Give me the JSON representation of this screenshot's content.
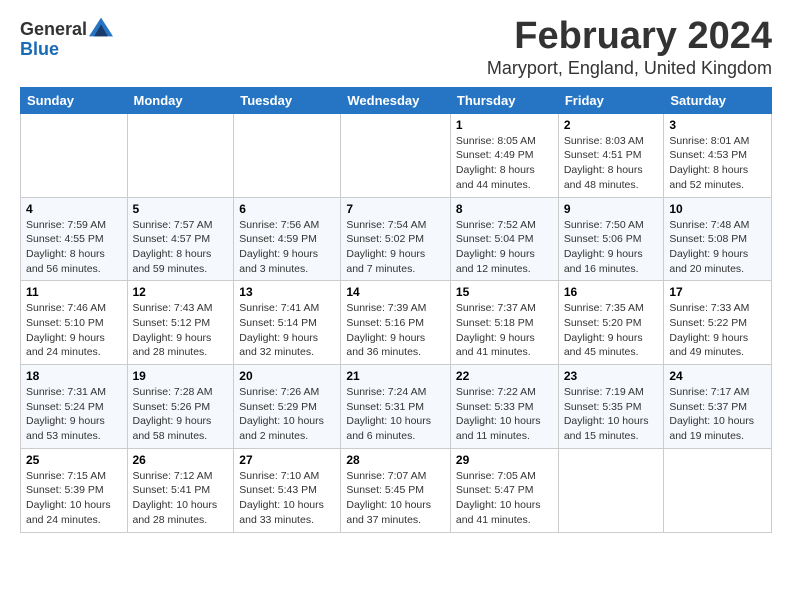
{
  "header": {
    "logo_general": "General",
    "logo_blue": "Blue",
    "title": "February 2024",
    "subtitle": "Maryport, England, United Kingdom"
  },
  "columns": [
    "Sunday",
    "Monday",
    "Tuesday",
    "Wednesday",
    "Thursday",
    "Friday",
    "Saturday"
  ],
  "weeks": [
    {
      "days": [
        {
          "num": "",
          "info": ""
        },
        {
          "num": "",
          "info": ""
        },
        {
          "num": "",
          "info": ""
        },
        {
          "num": "",
          "info": ""
        },
        {
          "num": "1",
          "info": "Sunrise: 8:05 AM\nSunset: 4:49 PM\nDaylight: 8 hours\nand 44 minutes."
        },
        {
          "num": "2",
          "info": "Sunrise: 8:03 AM\nSunset: 4:51 PM\nDaylight: 8 hours\nand 48 minutes."
        },
        {
          "num": "3",
          "info": "Sunrise: 8:01 AM\nSunset: 4:53 PM\nDaylight: 8 hours\nand 52 minutes."
        }
      ]
    },
    {
      "days": [
        {
          "num": "4",
          "info": "Sunrise: 7:59 AM\nSunset: 4:55 PM\nDaylight: 8 hours\nand 56 minutes."
        },
        {
          "num": "5",
          "info": "Sunrise: 7:57 AM\nSunset: 4:57 PM\nDaylight: 8 hours\nand 59 minutes."
        },
        {
          "num": "6",
          "info": "Sunrise: 7:56 AM\nSunset: 4:59 PM\nDaylight: 9 hours\nand 3 minutes."
        },
        {
          "num": "7",
          "info": "Sunrise: 7:54 AM\nSunset: 5:02 PM\nDaylight: 9 hours\nand 7 minutes."
        },
        {
          "num": "8",
          "info": "Sunrise: 7:52 AM\nSunset: 5:04 PM\nDaylight: 9 hours\nand 12 minutes."
        },
        {
          "num": "9",
          "info": "Sunrise: 7:50 AM\nSunset: 5:06 PM\nDaylight: 9 hours\nand 16 minutes."
        },
        {
          "num": "10",
          "info": "Sunrise: 7:48 AM\nSunset: 5:08 PM\nDaylight: 9 hours\nand 20 minutes."
        }
      ]
    },
    {
      "days": [
        {
          "num": "11",
          "info": "Sunrise: 7:46 AM\nSunset: 5:10 PM\nDaylight: 9 hours\nand 24 minutes."
        },
        {
          "num": "12",
          "info": "Sunrise: 7:43 AM\nSunset: 5:12 PM\nDaylight: 9 hours\nand 28 minutes."
        },
        {
          "num": "13",
          "info": "Sunrise: 7:41 AM\nSunset: 5:14 PM\nDaylight: 9 hours\nand 32 minutes."
        },
        {
          "num": "14",
          "info": "Sunrise: 7:39 AM\nSunset: 5:16 PM\nDaylight: 9 hours\nand 36 minutes."
        },
        {
          "num": "15",
          "info": "Sunrise: 7:37 AM\nSunset: 5:18 PM\nDaylight: 9 hours\nand 41 minutes."
        },
        {
          "num": "16",
          "info": "Sunrise: 7:35 AM\nSunset: 5:20 PM\nDaylight: 9 hours\nand 45 minutes."
        },
        {
          "num": "17",
          "info": "Sunrise: 7:33 AM\nSunset: 5:22 PM\nDaylight: 9 hours\nand 49 minutes."
        }
      ]
    },
    {
      "days": [
        {
          "num": "18",
          "info": "Sunrise: 7:31 AM\nSunset: 5:24 PM\nDaylight: 9 hours\nand 53 minutes."
        },
        {
          "num": "19",
          "info": "Sunrise: 7:28 AM\nSunset: 5:26 PM\nDaylight: 9 hours\nand 58 minutes."
        },
        {
          "num": "20",
          "info": "Sunrise: 7:26 AM\nSunset: 5:29 PM\nDaylight: 10 hours\nand 2 minutes."
        },
        {
          "num": "21",
          "info": "Sunrise: 7:24 AM\nSunset: 5:31 PM\nDaylight: 10 hours\nand 6 minutes."
        },
        {
          "num": "22",
          "info": "Sunrise: 7:22 AM\nSunset: 5:33 PM\nDaylight: 10 hours\nand 11 minutes."
        },
        {
          "num": "23",
          "info": "Sunrise: 7:19 AM\nSunset: 5:35 PM\nDaylight: 10 hours\nand 15 minutes."
        },
        {
          "num": "24",
          "info": "Sunrise: 7:17 AM\nSunset: 5:37 PM\nDaylight: 10 hours\nand 19 minutes."
        }
      ]
    },
    {
      "days": [
        {
          "num": "25",
          "info": "Sunrise: 7:15 AM\nSunset: 5:39 PM\nDaylight: 10 hours\nand 24 minutes."
        },
        {
          "num": "26",
          "info": "Sunrise: 7:12 AM\nSunset: 5:41 PM\nDaylight: 10 hours\nand 28 minutes."
        },
        {
          "num": "27",
          "info": "Sunrise: 7:10 AM\nSunset: 5:43 PM\nDaylight: 10 hours\nand 33 minutes."
        },
        {
          "num": "28",
          "info": "Sunrise: 7:07 AM\nSunset: 5:45 PM\nDaylight: 10 hours\nand 37 minutes."
        },
        {
          "num": "29",
          "info": "Sunrise: 7:05 AM\nSunset: 5:47 PM\nDaylight: 10 hours\nand 41 minutes."
        },
        {
          "num": "",
          "info": ""
        },
        {
          "num": "",
          "info": ""
        }
      ]
    }
  ]
}
